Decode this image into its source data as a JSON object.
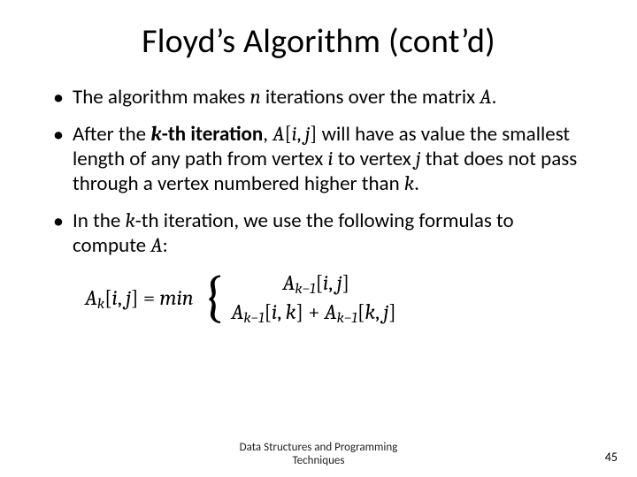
{
  "title": "Floyd’s Algorithm (cont’d)",
  "bullets": {
    "b1": {
      "pre": "The algorithm makes ",
      "n": "n",
      "mid": " iterations over the matrix ",
      "A": "A",
      "post": "."
    },
    "b2": {
      "pre": "After the ",
      "kth": "k-th iteration",
      "comma": ", ",
      "Aij": "A[i, j]",
      "mid1": " will have as value the smallest length of any path from vertex ",
      "i": "i",
      "mid2": " to vertex ",
      "j": "j",
      "mid3": " that does not pass through a vertex numbered higher than ",
      "k": "k",
      "post": "."
    },
    "b3": {
      "pre": "In the ",
      "kth": "k",
      "kthsuf": "-th iteration, we use the following formulas to compute ",
      "A": "A",
      "post": ":"
    }
  },
  "formula": {
    "lhs_A": "A",
    "lhs_sub": "k",
    "lhs_idx": "[i, j]",
    "eq": " = ",
    "min": "min",
    "case1_A": "A",
    "case1_sub": "k−1",
    "case1_idx": "[i, j]",
    "case2a_A": "A",
    "case2a_sub": "k−1",
    "case2a_idx": "[i, k]",
    "plus": " + ",
    "case2b_A": "A",
    "case2b_sub": "k−1",
    "case2b_idx": "[k, j]"
  },
  "footer": {
    "line1": "Data Structures and Programming",
    "line2": "Techniques"
  },
  "page": "45"
}
